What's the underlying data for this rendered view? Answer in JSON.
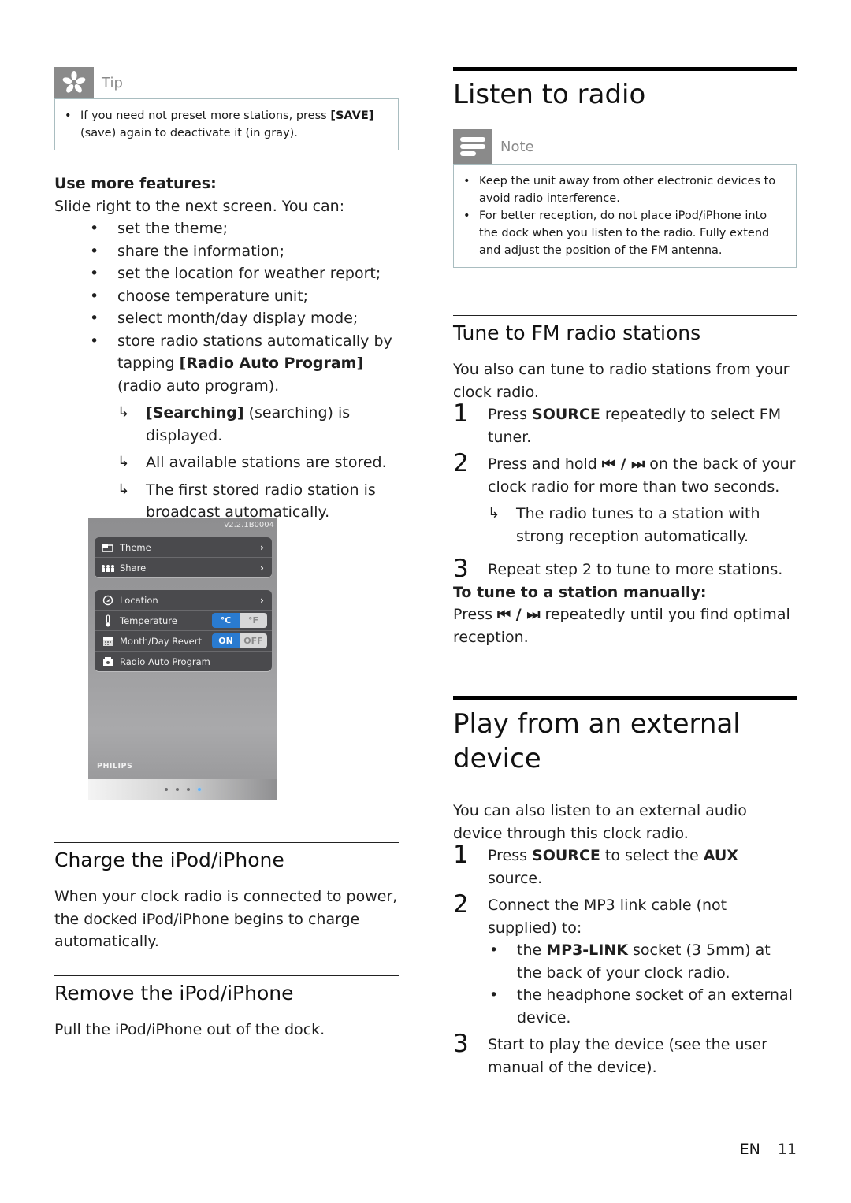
{
  "tip": {
    "label": "Tip",
    "items": [
      {
        "pre": "If you need not preset more stations, press ",
        "bold": "[SAVE]",
        "post": " (save) again to deactivate it (in gray)."
      }
    ]
  },
  "features": {
    "heading": "Use more features:",
    "intro": "Slide right to the next screen. You can:",
    "items": [
      "set the theme;",
      "share the information;",
      "set the location for weather report;",
      "choose temperature unit;",
      "select month/day display mode;"
    ],
    "last_item": {
      "pre": "store radio stations automatically by tapping ",
      "bold": "[Radio Auto Program]",
      "post": " (radio auto program)."
    },
    "results": [
      {
        "bold": "[Searching]",
        "post": " (searching) is displayed."
      },
      {
        "bold": "",
        "post": "All available stations are stored."
      },
      {
        "bold": "",
        "post": "The first stored radio station is broadcast automatically."
      }
    ]
  },
  "device": {
    "version": "v2.2.1B0004",
    "group1": [
      {
        "label": "Theme",
        "icon": "theme-icon"
      },
      {
        "label": "Share",
        "icon": "share-icon"
      }
    ],
    "group2": [
      {
        "label": "Location",
        "icon": "compass-icon"
      },
      {
        "label": "Temperature",
        "icon": "thermometer-icon",
        "options": [
          "°C",
          "°F"
        ],
        "selected": "°C"
      },
      {
        "label": "Month/Day Revert",
        "icon": "calendar-icon",
        "options": [
          "ON",
          "OFF"
        ],
        "selected": "ON"
      },
      {
        "label": "Radio Auto Program",
        "icon": "radio-icon"
      }
    ],
    "brand": "PHILIPS",
    "page_dots": 4,
    "active_dot": 4
  },
  "charge": {
    "title": "Charge the iPod/iPhone",
    "body": "When your clock radio is connected to power, the docked iPod/iPhone begins to charge automatically."
  },
  "remove": {
    "title": "Remove the iPod/iPhone",
    "body": "Pull the iPod/iPhone out of the dock."
  },
  "listen": {
    "title": "Listen to radio",
    "note_label": "Note",
    "notes": [
      "Keep the unit away from other electronic devices to avoid radio interference.",
      "For better reception, do not place iPod/iPhone into the dock when you listen to the radio. Fully extend and adjust the position of the FM antenna."
    ]
  },
  "tune": {
    "title": "Tune to FM radio stations",
    "intro": "You also can tune to radio stations from your clock radio.",
    "step1": {
      "num": "1",
      "pre": "Press ",
      "bold": "SOURCE",
      "post": " repeatedly to select FM tuner."
    },
    "step2": {
      "num": "2",
      "pre": "Press and hold ",
      "bold": "⏮ / ⏭",
      "post": " on the back of your clock radio for more than two seconds.",
      "result": "The radio tunes to a station with strong reception automatically."
    },
    "step3": {
      "num": "3",
      "text": "Repeat step 2 to tune to more stations."
    },
    "manual_heading": "To tune to a station manually:",
    "manual": {
      "pre": "Press ",
      "bold": "⏮ / ⏭",
      "post": " repeatedly until you find optimal reception."
    }
  },
  "external": {
    "title": "Play from an external device",
    "intro": "You can also listen to an external audio device through this clock radio.",
    "step1": {
      "num": "1",
      "pre": "Press ",
      "bold1": "SOURCE",
      "mid": " to select the ",
      "bold2": "AUX",
      "post": " source."
    },
    "step2": {
      "num": "2",
      "text": "Connect the MP3 link cable (not supplied) to:"
    },
    "step2_items": [
      {
        "pre": "the ",
        "bold": "MP3-LINK",
        "post": " socket (3 5mm) at the back of your clock radio."
      },
      {
        "pre": "",
        "bold": "",
        "post": "the headphone socket of an external device."
      }
    ],
    "step3": {
      "num": "3",
      "text": "Start to play the device (see the user manual of the device)."
    }
  },
  "footer": {
    "lang": "EN",
    "page": "11"
  }
}
